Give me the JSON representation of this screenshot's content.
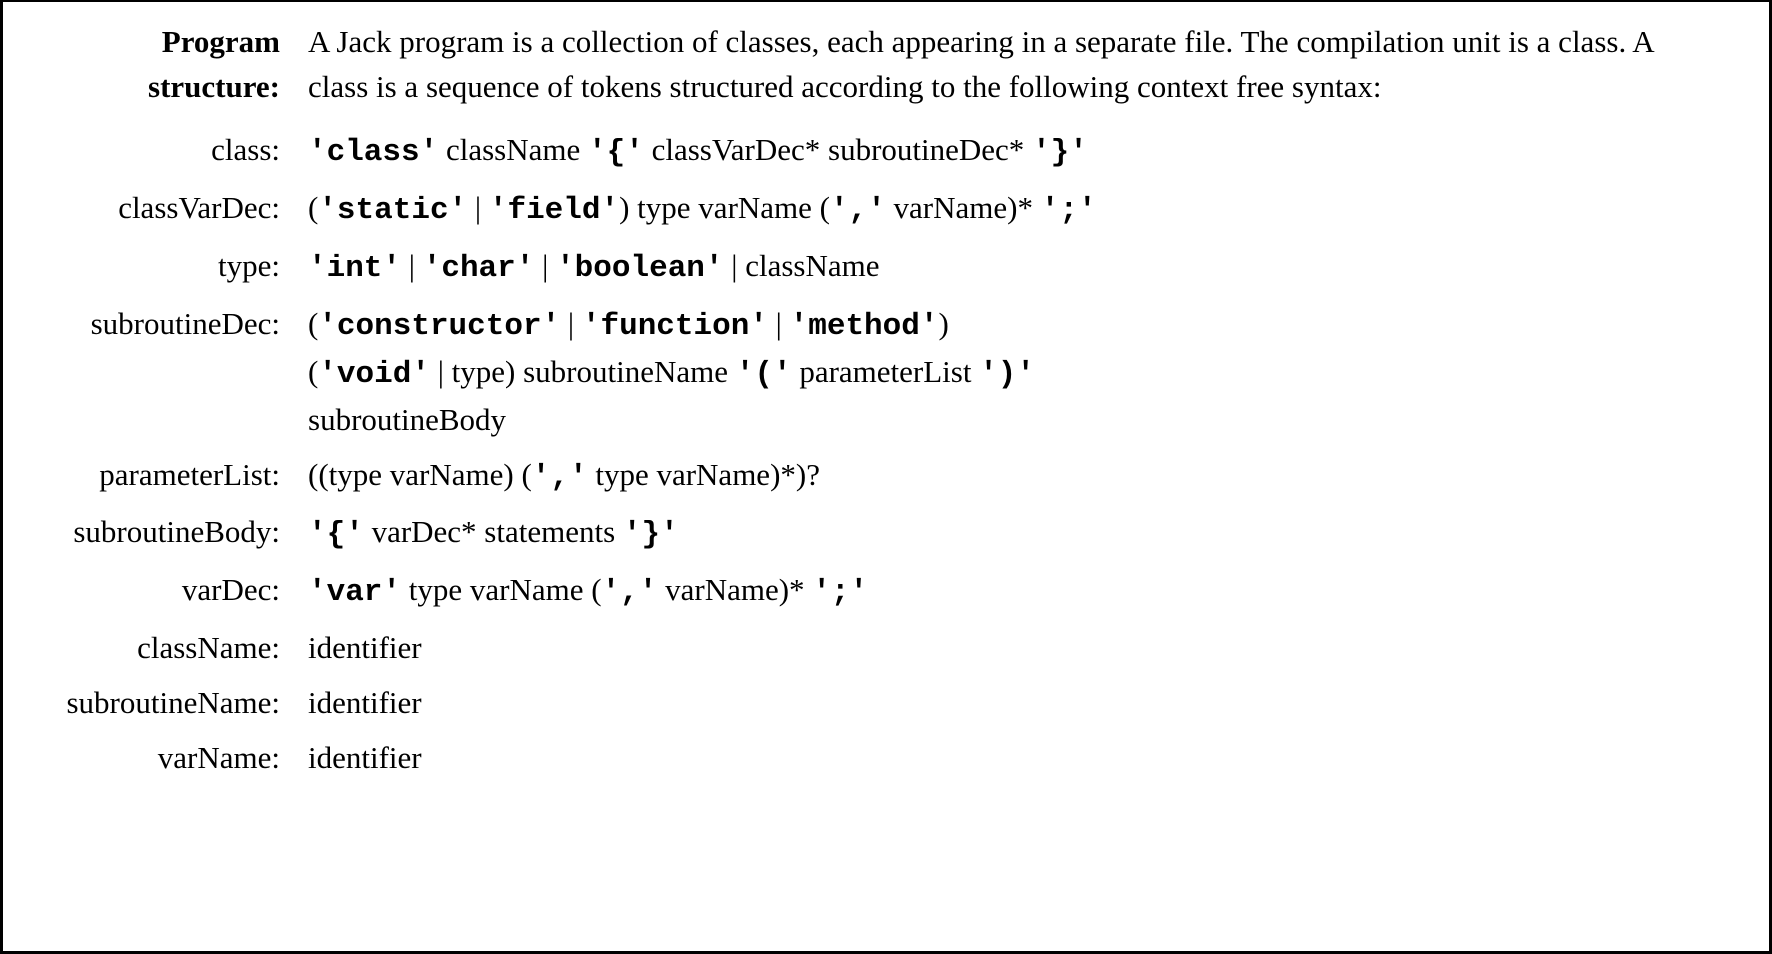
{
  "intro": {
    "label": "Program structure:",
    "text": "A Jack program is a collection of classes, each appearing in a separate file. The compilation unit is a class. A class is a sequence of tokens structured according to the following context free syntax:"
  },
  "rules": {
    "class": {
      "label": "class:",
      "p": [
        {
          "t": "tok",
          "v": "'class'"
        },
        {
          "t": "txt",
          "v": " className "
        },
        {
          "t": "tok",
          "v": "'{'"
        },
        {
          "t": "txt",
          "v": " classVarDec* subroutineDec* "
        },
        {
          "t": "tok",
          "v": "'}'"
        }
      ]
    },
    "classVarDec": {
      "label": "classVarDec:",
      "p": [
        {
          "t": "txt",
          "v": "("
        },
        {
          "t": "tok",
          "v": "'static'"
        },
        {
          "t": "txt",
          "v": " | "
        },
        {
          "t": "tok",
          "v": "'field'"
        },
        {
          "t": "txt",
          "v": ") type varName ("
        },
        {
          "t": "tok",
          "v": "','"
        },
        {
          "t": "txt",
          "v": " varName)* "
        },
        {
          "t": "tok",
          "v": "';'"
        }
      ]
    },
    "type": {
      "label": "type:",
      "p": [
        {
          "t": "tok",
          "v": "'int'"
        },
        {
          "t": "txt",
          "v": " | "
        },
        {
          "t": "tok",
          "v": "'char'"
        },
        {
          "t": "txt",
          "v": " | "
        },
        {
          "t": "tok",
          "v": "'boolean'"
        },
        {
          "t": "txt",
          "v": " | className"
        }
      ]
    },
    "subroutineDec": {
      "label": "subroutineDec:",
      "lines": [
        [
          {
            "t": "txt",
            "v": "("
          },
          {
            "t": "tok",
            "v": "'constructor'"
          },
          {
            "t": "txt",
            "v": " | "
          },
          {
            "t": "tok",
            "v": "'function'"
          },
          {
            "t": "txt",
            "v": " | "
          },
          {
            "t": "tok",
            "v": "'method'"
          },
          {
            "t": "txt",
            "v": ")"
          }
        ],
        [
          {
            "t": "txt",
            "v": "("
          },
          {
            "t": "tok",
            "v": "'void'"
          },
          {
            "t": "txt",
            "v": " | type) subroutineName "
          },
          {
            "t": "tok",
            "v": "'('"
          },
          {
            "t": "txt",
            "v": " parameterList "
          },
          {
            "t": "tok",
            "v": "')'"
          }
        ],
        [
          {
            "t": "txt",
            "v": "subroutineBody"
          }
        ]
      ]
    },
    "parameterList": {
      "label": "parameterList:",
      "p": [
        {
          "t": "txt",
          "v": "((type varName) ("
        },
        {
          "t": "tok",
          "v": "','"
        },
        {
          "t": "txt",
          "v": " type varName)*)?"
        }
      ]
    },
    "subroutineBody": {
      "label": "subroutineBody:",
      "p": [
        {
          "t": "tok",
          "v": "'{'"
        },
        {
          "t": "txt",
          "v": " varDec* statements "
        },
        {
          "t": "tok",
          "v": "'}'"
        }
      ]
    },
    "varDec": {
      "label": "varDec:",
      "p": [
        {
          "t": "tok",
          "v": "'var'"
        },
        {
          "t": "txt",
          "v": " type varName ("
        },
        {
          "t": "tok",
          "v": "','"
        },
        {
          "t": "txt",
          "v": " varName)* "
        },
        {
          "t": "tok",
          "v": "';'"
        }
      ]
    },
    "className": {
      "label": "className:",
      "p": [
        {
          "t": "txt",
          "v": "identifier"
        }
      ]
    },
    "subroutineName": {
      "label": "subroutineName:",
      "p": [
        {
          "t": "txt",
          "v": "identifier"
        }
      ]
    },
    "varName": {
      "label": "varName:",
      "p": [
        {
          "t": "txt",
          "v": "identifier"
        }
      ]
    }
  }
}
